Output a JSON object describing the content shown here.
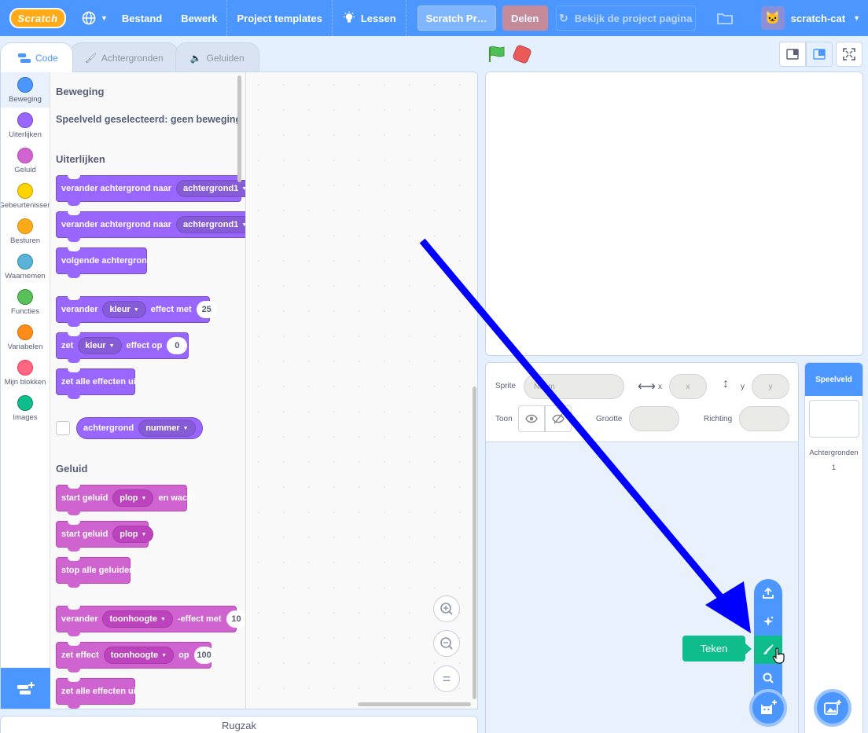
{
  "menubar": {
    "logo": "Scratch",
    "file": "Bestand",
    "edit": "Bewerk",
    "templates": "Project templates",
    "tutorials": "Lessen",
    "project_title": "Scratch Pr…",
    "share": "Delen",
    "see_project_page": "Bekijk de project pagina",
    "username": "scratch-cat"
  },
  "tabs": [
    {
      "label": "Code"
    },
    {
      "label": "Achtergronden"
    },
    {
      "label": "Geluiden"
    }
  ],
  "categories": [
    {
      "label": "Beweging",
      "color": "#4c97ff"
    },
    {
      "label": "Uiterlijken",
      "color": "#9966ff"
    },
    {
      "label": "Geluid",
      "color": "#cf63cf"
    },
    {
      "label": "Gebeurtenissen",
      "color": "#ffd500"
    },
    {
      "label": "Besturen",
      "color": "#ffab19"
    },
    {
      "label": "Waarnemen",
      "color": "#5cb1d6"
    },
    {
      "label": "Functies",
      "color": "#59c059"
    },
    {
      "label": "Variabelen",
      "color": "#ff8c1a"
    },
    {
      "label": "Mijn blokken",
      "color": "#ff6680"
    },
    {
      "label": "Images",
      "color": "#0fbd8c"
    }
  ],
  "palette": {
    "motion_heading": "Beweging",
    "motion_note": "Speelveld geselecteerd: geen beweging",
    "looks_heading": "Uiterlijken",
    "sound_heading": "Geluid",
    "blocks": {
      "switch_backdrop": {
        "text": "verander achtergrond naar",
        "menu": "achtergrond1"
      },
      "switch_backdrop_wait": {
        "text": "verander achtergrond naar",
        "menu": "achtergrond1",
        "tail": "e"
      },
      "next_backdrop": {
        "text": "volgende achtergrond"
      },
      "change_effect": {
        "text1": "verander",
        "menu": "kleur",
        "text2": "effect met",
        "value": "25"
      },
      "set_effect": {
        "text1": "zet",
        "menu": "kleur",
        "text2": "effect op",
        "value": "0"
      },
      "clear_effects": {
        "text": "zet alle effecten uit"
      },
      "backdrop_reporter": {
        "text": "achtergrond",
        "menu": "nummer"
      },
      "play_sound_wait": {
        "text1": "start geluid",
        "menu": "plop",
        "text2": "en wacht"
      },
      "play_sound": {
        "text1": "start geluid",
        "menu": "plop"
      },
      "stop_sounds": {
        "text": "stop alle geluiden"
      },
      "change_pitch": {
        "text1": "verander",
        "menu": "toonhoogte",
        "text2": "-effect met",
        "value": "10"
      },
      "set_pitch": {
        "text1": "zet effect",
        "menu": "toonhoogte",
        "text2": "op",
        "value": "100"
      },
      "clear_sound_effects": {
        "text": "zet alle effecten uit"
      }
    }
  },
  "backpack": "Rugzak",
  "sprite_info": {
    "sprite_label": "Sprite",
    "name_placeholder": "Naam",
    "x_label": "x",
    "x_placeholder": "x",
    "y_label": "y",
    "y_placeholder": "y",
    "show_label": "Toon",
    "size_label": "Grootte",
    "direction_label": "Richting"
  },
  "stage_selector": {
    "title": "Speelveld",
    "backdrops_label": "Achtergronden",
    "backdrops_count": "1"
  },
  "add_sprite_menu": {
    "tooltip": "Teken",
    "items": [
      "upload-icon",
      "surprise-icon",
      "paint-icon",
      "search-icon"
    ]
  },
  "colors": {
    "menubar": "#4c97ff",
    "looks": "#9966ff",
    "sound": "#cf63cf",
    "paint_hover": "#0fbd8c",
    "annotation_arrow": "#0000ff"
  }
}
